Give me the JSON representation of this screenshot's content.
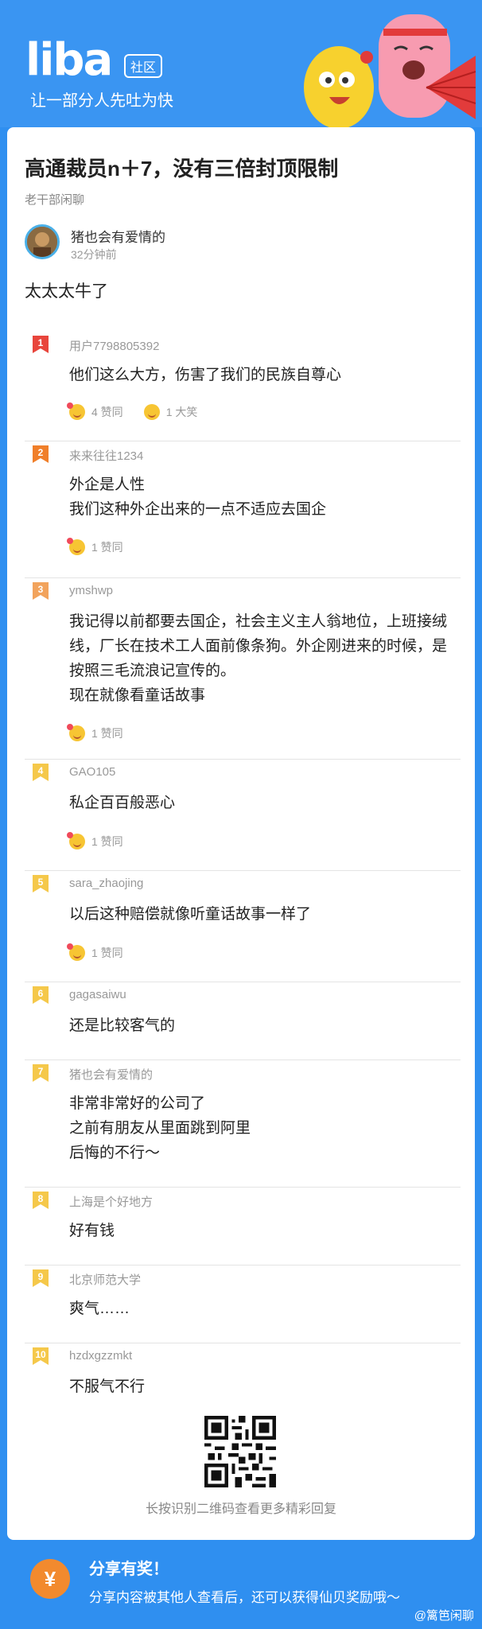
{
  "header": {
    "logo": "liba",
    "logo_tag": "社区",
    "slogan": "让一部分人先吐为快"
  },
  "post": {
    "title": "高通裁员n＋7，没有三倍封顶限制",
    "board": "老干部闲聊",
    "author": "猪也会有爱情的",
    "time": "32分钟前",
    "body": "太太太牛了"
  },
  "replies": [
    {
      "rank": "1",
      "user": "用户7798805392",
      "lines": [
        "他们这么大方，伤害了我们的民族自尊心"
      ],
      "reacts": [
        {
          "icon": "agree-emoji-icon",
          "label": "4 赞同"
        },
        {
          "icon": "laugh-emoji-icon",
          "label": "1 大笑"
        }
      ],
      "color": "#e8453c"
    },
    {
      "rank": "2",
      "user": "来来往往1234",
      "lines": [
        "外企是人性",
        "我们这种外企出来的一点不适应去国企"
      ],
      "reacts": [
        {
          "icon": "agree-emoji-icon",
          "label": "1 赞同"
        }
      ],
      "color": "#f07f2a"
    },
    {
      "rank": "3",
      "user": "ymshwp",
      "lines": [
        "我记得以前都要去国企，社会主义主人翁地位，上班接绒",
        "线，厂长在技术工人面前像条狗。外企刚进来的时候，是",
        "按照三毛流浪记宣传的。",
        "现在就像看童话故事"
      ],
      "reacts": [
        {
          "icon": "agree-emoji-icon",
          "label": "1 赞同"
        }
      ],
      "color": "#f2a35c"
    },
    {
      "rank": "4",
      "user": "GAO105",
      "lines": [
        "私企百百般恶心"
      ],
      "reacts": [
        {
          "icon": "agree-emoji-icon",
          "label": "1 赞同"
        }
      ],
      "color": "#f5c84a"
    },
    {
      "rank": "5",
      "user": "sara_zhaojing",
      "lines": [
        "以后这种赔偿就像听童话故事一样了"
      ],
      "reacts": [
        {
          "icon": "agree-emoji-icon",
          "label": "1 赞同"
        }
      ],
      "color": "#f5c84a"
    },
    {
      "rank": "6",
      "user": "gagasaiwu",
      "lines": [
        "还是比较客气的"
      ],
      "reacts": [],
      "color": "#f5c84a"
    },
    {
      "rank": "7",
      "user": "猪也会有爱情的",
      "lines": [
        "非常非常好的公司了",
        "之前有朋友从里面跳到阿里",
        "后悔的不行～"
      ],
      "reacts": [],
      "color": "#f5c84a"
    },
    {
      "rank": "8",
      "user": "上海是个好地方",
      "lines": [
        "好有钱"
      ],
      "reacts": [],
      "color": "#f5c84a"
    },
    {
      "rank": "9",
      "user": "北京师范大学",
      "lines": [
        "爽气……"
      ],
      "reacts": [],
      "color": "#f5c84a"
    },
    {
      "rank": "10",
      "user": "hzdxgzzmkt",
      "lines": [
        "不服气不行"
      ],
      "reacts": [],
      "color": "#f5c84a"
    }
  ],
  "qr_caption": "长按识别二维码查看更多精彩回复",
  "footer": {
    "coin": "¥",
    "title": "分享有奖！",
    "subtitle": "分享内容被其他人查看后，还可以获得仙贝奖励哦～",
    "watermark": "@篱笆闲聊"
  }
}
